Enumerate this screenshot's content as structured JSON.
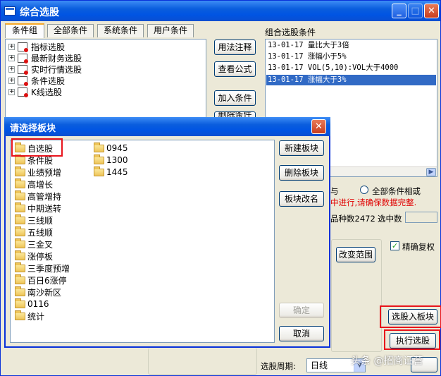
{
  "window": {
    "title": "综合选股"
  },
  "tabs": [
    "条件组",
    "全部条件",
    "系统条件",
    "用户条件"
  ],
  "tree": [
    {
      "label": "指标选股"
    },
    {
      "label": "最新财务选股"
    },
    {
      "label": "实时行情选股"
    },
    {
      "label": "条件选股"
    },
    {
      "label": "K线选股"
    }
  ],
  "middle_buttons": {
    "usage": "用法注释",
    "view_formula": "查看公式",
    "add": "加入条件",
    "delete": "删除条件"
  },
  "conditions": {
    "label": "组合选股条件",
    "rows": [
      "13-01-17  量比大于3倍",
      "13-01-17  涨幅小于5%",
      "13-01-17  VOL(5,10):VOL大于4000",
      "13-01-17  涨幅大于3%"
    ],
    "selected_index": 3
  },
  "logic": {
    "and_partial": "与",
    "all_or": "全部条件相或"
  },
  "warning": "中进行,请确保数据完整.",
  "stats": {
    "count_label_partial": "品种数",
    "count_value": "2472",
    "selected_label": "选中数"
  },
  "options": {
    "precise_adjust": "精确复权",
    "precise_adjust_checked": true,
    "change_range": "改变范围"
  },
  "actions": {
    "select_to_block": "选股入板块",
    "execute": "执行选股"
  },
  "period": {
    "label": "选股周期:",
    "value": "日线"
  },
  "watermark": "头条 @招商证营",
  "dialog": {
    "title": "请选择板块",
    "blocks": [
      "自选股",
      "条件股",
      "业绩预增",
      "高增长",
      "高管增持",
      "中期送转",
      "三线顺",
      "五线顺",
      "三金叉",
      "涨停板",
      "三季度预增",
      "百日6涨停",
      "南沙新区",
      "0116",
      "统计",
      "0945",
      "1300",
      "1445"
    ],
    "buttons": {
      "new": "新建板块",
      "delete": "删除板块",
      "rename": "板块改名",
      "ok": "确定",
      "cancel": "取消"
    }
  }
}
